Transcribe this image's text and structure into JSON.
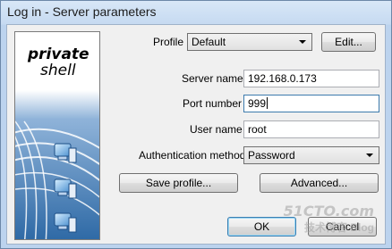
{
  "window": {
    "title": "Log in - Server parameters"
  },
  "logo": {
    "line1": "private",
    "line2": "shell",
    "icon": "network-computers-icon"
  },
  "profile": {
    "label": "Profile",
    "selected": "Default",
    "edit_label": "Edit..."
  },
  "server_name": {
    "label": "Server name",
    "value": "192.168.0.173"
  },
  "port_number": {
    "label": "Port number",
    "value": "999"
  },
  "user_name": {
    "label": "User name",
    "value": "root"
  },
  "auth_method": {
    "label": "Authentication method",
    "selected": "Password"
  },
  "buttons": {
    "save_profile": "Save profile...",
    "advanced": "Advanced...",
    "ok": "OK",
    "cancel": "Cancel"
  },
  "watermark": {
    "line1": "51CTO.com",
    "line2": "技术博客 Blog"
  },
  "colors": {
    "logo_background": "#2f6aa6",
    "focus_border": "#3d7bad"
  }
}
